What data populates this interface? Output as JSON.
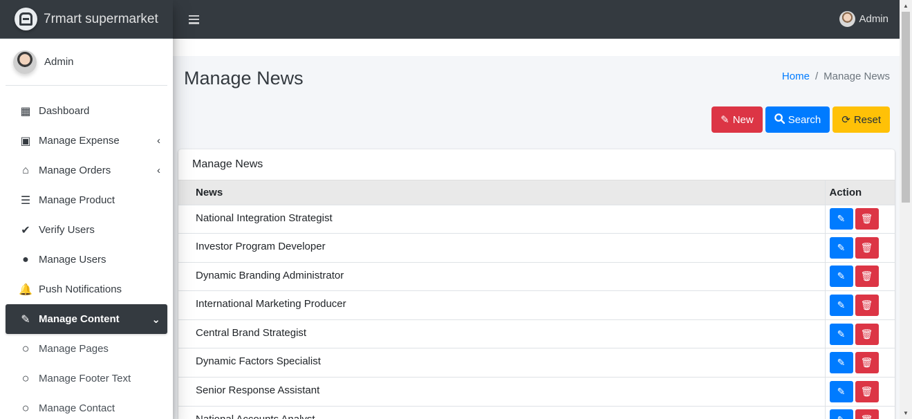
{
  "brand": {
    "name": "7rmart supermarket"
  },
  "sidebar_user": {
    "name": "Admin"
  },
  "topbar": {
    "user_name": "Admin"
  },
  "sidebar": {
    "items": [
      {
        "label": "Dashboard",
        "icon": "dashboard-icon",
        "glyph": "▦",
        "arrow": ""
      },
      {
        "label": "Manage Expense",
        "icon": "money-icon",
        "glyph": "▣",
        "arrow": "‹"
      },
      {
        "label": "Manage Orders",
        "icon": "basket-icon",
        "glyph": "⌂",
        "arrow": "‹"
      },
      {
        "label": "Manage Product",
        "icon": "tasks-icon",
        "glyph": "☰",
        "arrow": ""
      },
      {
        "label": "Verify Users",
        "icon": "user-check-icon",
        "glyph": "✔",
        "arrow": ""
      },
      {
        "label": "Manage Users",
        "icon": "user-icon",
        "glyph": "●",
        "arrow": ""
      },
      {
        "label": "Push Notifications",
        "icon": "bell-icon",
        "glyph": "🔔",
        "arrow": ""
      },
      {
        "label": "Manage Content",
        "icon": "edit-icon",
        "glyph": "✎",
        "arrow": "⌄",
        "active": true
      },
      {
        "label": "Manage Pages",
        "icon": "circle-icon",
        "glyph": "○",
        "arrow": "",
        "sub": true
      },
      {
        "label": "Manage Footer Text",
        "icon": "circle-icon",
        "glyph": "○",
        "arrow": "",
        "sub": true
      },
      {
        "label": "Manage Contact",
        "icon": "circle-icon",
        "glyph": "○",
        "arrow": "",
        "sub": true
      }
    ]
  },
  "page": {
    "title": "Manage News",
    "breadcrumb": {
      "home": "Home",
      "separator": "/",
      "current": "Manage News"
    }
  },
  "buttons": {
    "new": "New",
    "search": "Search",
    "reset": "Reset"
  },
  "card": {
    "title": "Manage News",
    "columns": [
      "News",
      "Action"
    ],
    "rows": [
      "National Integration Strategist",
      "Investor Program Developer",
      "Dynamic Branding Administrator",
      "International Marketing Producer",
      "Central Brand Strategist",
      "Dynamic Factors Specialist",
      "Senior Response Assistant",
      "National Accounts Analyst"
    ]
  },
  "colors": {
    "dark": "#343a40",
    "primary": "#007bff",
    "danger": "#dc3545",
    "warning": "#ffc107"
  }
}
